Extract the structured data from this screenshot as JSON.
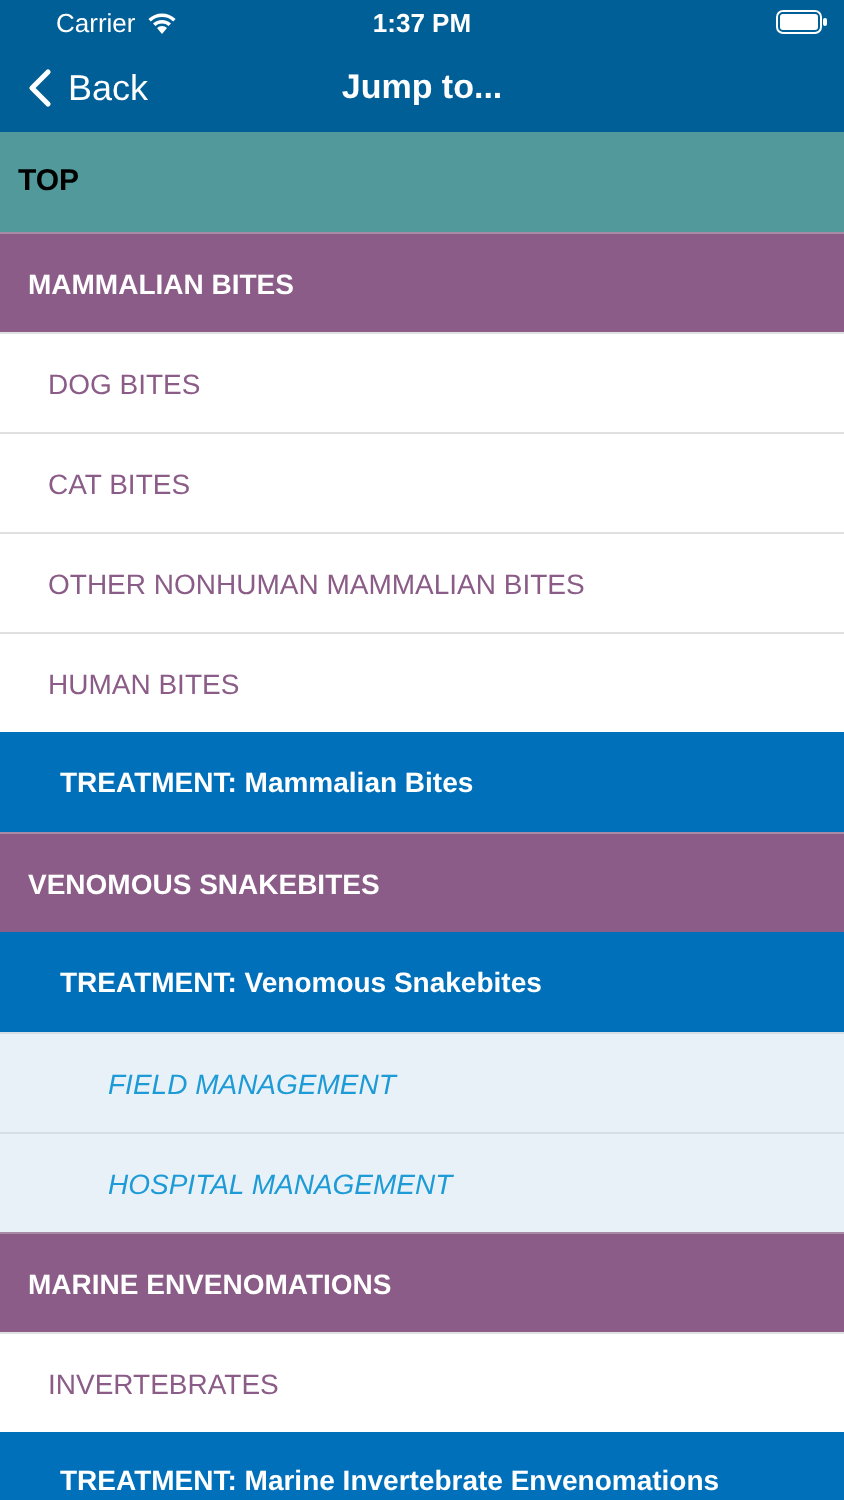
{
  "status_bar": {
    "carrier": "Carrier",
    "time": "1:37 PM"
  },
  "nav": {
    "back": "Back",
    "title": "Jump to..."
  },
  "rows": [
    {
      "kind": "top",
      "label": "TOP"
    },
    {
      "kind": "section",
      "label": "MAMMALIAN BITES"
    },
    {
      "kind": "item",
      "label": "DOG BITES"
    },
    {
      "kind": "item",
      "label": "CAT BITES"
    },
    {
      "kind": "item",
      "label": "OTHER NONHUMAN MAMMALIAN BITES"
    },
    {
      "kind": "item",
      "label": "HUMAN BITES"
    },
    {
      "kind": "treatment",
      "label": "TREATMENT: Mammalian Bites"
    },
    {
      "kind": "section",
      "label": "VENOMOUS SNAKEBITES"
    },
    {
      "kind": "treatment",
      "label": "TREATMENT: Venomous Snakebites"
    },
    {
      "kind": "subitem",
      "label": "FIELD MANAGEMENT"
    },
    {
      "kind": "subitem",
      "label": "HOSPITAL MANAGEMENT"
    },
    {
      "kind": "section",
      "label": "MARINE ENVENOMATIONS"
    },
    {
      "kind": "item",
      "label": "INVERTEBRATES"
    },
    {
      "kind": "treatment",
      "label": "TREATMENT: Marine Invertebrate Envenomations"
    }
  ]
}
